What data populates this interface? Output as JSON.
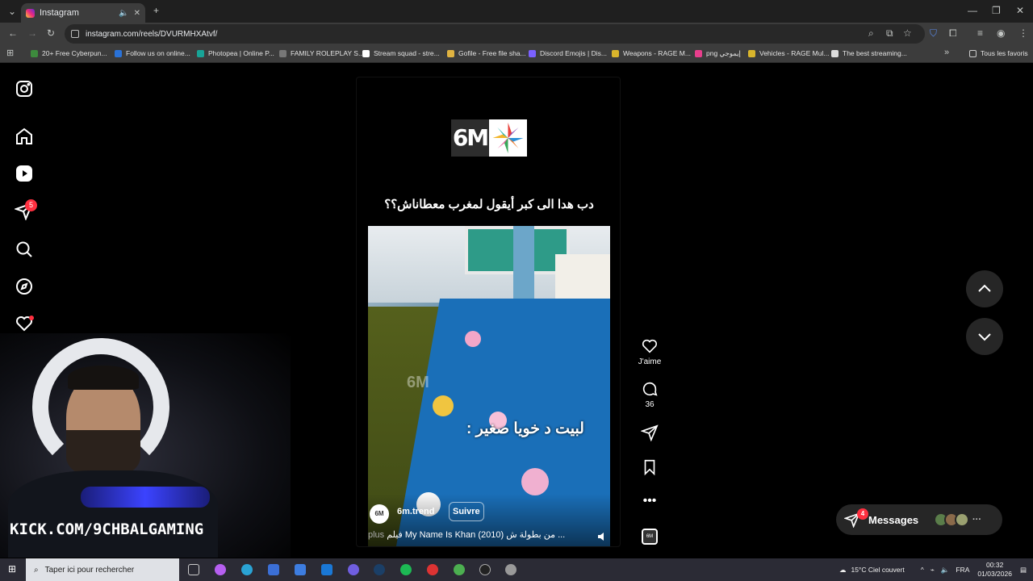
{
  "browser": {
    "tab_title": "Instagram",
    "url": "instagram.com/reels/DVURMHXAtvf/",
    "bookmarks": [
      {
        "label": "20+ Free Cyberpun...",
        "color": "#3d8a3d"
      },
      {
        "label": "Follow us on online...",
        "color": "#2a72d8"
      },
      {
        "label": "Photopea | Online P...",
        "color": "#18a497"
      },
      {
        "label": "FAMILY ROLEPLAY S...",
        "color": "#777777"
      },
      {
        "label": "Stream squad - stre...",
        "color": "#ffffff"
      },
      {
        "label": "Gofile - Free file sha...",
        "color": "#e0b341"
      },
      {
        "label": "Discord Emojis | Dis...",
        "color": "#7b61ff"
      },
      {
        "label": "Weapons - RAGE M...",
        "color": "#d9b52c"
      },
      {
        "label": "png إيموجي",
        "color": "#e83e8c"
      },
      {
        "label": "Vehicles - RAGE Mul...",
        "color": "#d9b52c"
      },
      {
        "label": "The best streaming...",
        "color": "#dddddd"
      }
    ],
    "all_bookmarks": "Tous les favoris"
  },
  "sidebar": {
    "notifications_count": "5"
  },
  "reel": {
    "logo_text": "6M",
    "caption": "دب هدا الى كبر أيقول لمغرب معطاناش؟؟",
    "video_overlay": "لبيت د خويا صغير :",
    "watermark": "6M",
    "author_avatar": "6M",
    "author": "6m.trend",
    "follow": "Suivre",
    "audio_line": "فيلم My Name Is Khan (2010) من بطولة ش ...",
    "audio_more": "plus"
  },
  "actions": {
    "like_label": "J'aime",
    "comments_count": "36"
  },
  "messages": {
    "label": "Messages",
    "badge": "4"
  },
  "stream": {
    "kick_url": "KICK.COM/9CHBALGAMING"
  },
  "taskbar": {
    "search_placeholder": "Taper ici pour rechercher",
    "weather": "15°C  Ciel couvert",
    "language": "FRA",
    "time": "00:32",
    "date": "01/03/2026"
  }
}
